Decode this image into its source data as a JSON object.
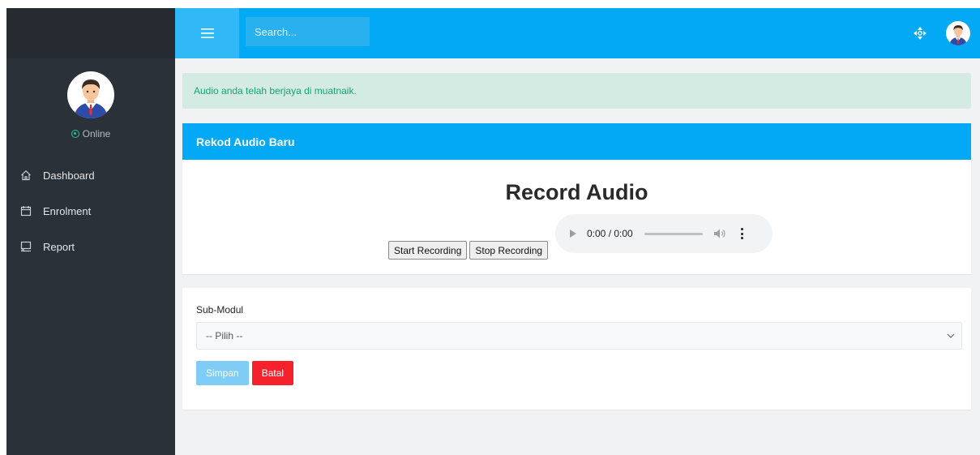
{
  "topbar": {
    "search_placeholder": "Search...",
    "icons": {
      "menu": "hamburger-icon",
      "crosshair": "crosshair-icon",
      "avatar": "user-avatar"
    }
  },
  "sidebar": {
    "status": "Online",
    "items": [
      {
        "label": "Dashboard",
        "icon": "home-icon"
      },
      {
        "label": "Enrolment",
        "icon": "calendar-icon"
      },
      {
        "label": "Report",
        "icon": "monitor-icon"
      }
    ]
  },
  "alert": {
    "message": "Audio anda telah berjaya di muatnaik."
  },
  "record_card": {
    "header": "Rekod Audio Baru",
    "title": "Record Audio",
    "start_label": "Start Recording",
    "stop_label": "Stop Recording",
    "audio_time": "0:00 / 0:00"
  },
  "form": {
    "submodul_label": "Sub-Modul",
    "submodul_selected": "-- Pilih --",
    "save_label": "Simpan",
    "cancel_label": "Batal"
  },
  "colors": {
    "primary": "#03a9f4",
    "sidebar": "#2b3138",
    "alert_bg": "#d4ebe3",
    "alert_text": "#17a374",
    "online": "#27c49a",
    "save": "#7fcdf7",
    "cancel": "#f5222d"
  }
}
